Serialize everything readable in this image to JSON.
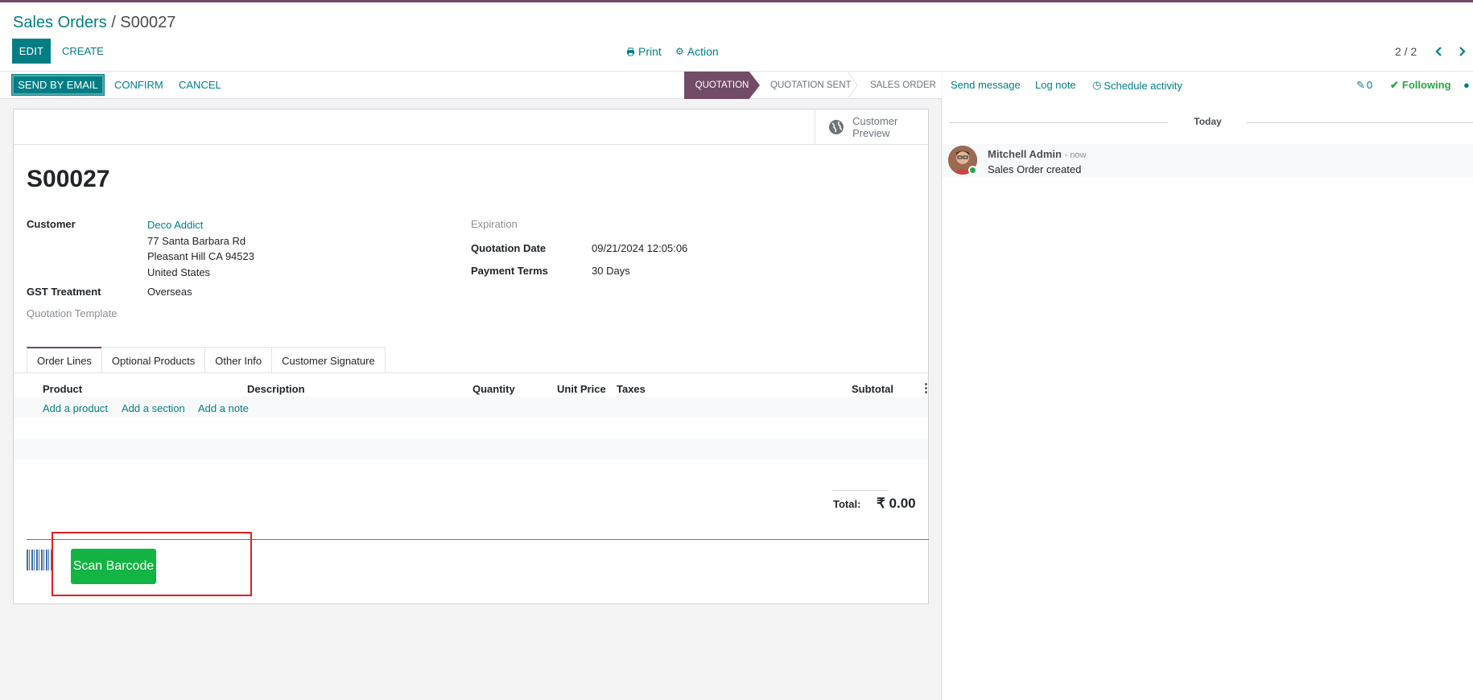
{
  "breadcrumb": {
    "parent": "Sales Orders",
    "sep": " / ",
    "current": "S00027"
  },
  "toolbar": {
    "edit": "EDIT",
    "create": "CREATE",
    "print": "Print",
    "action": "Action"
  },
  "pager": {
    "value": "2 / 2"
  },
  "statusbar": {
    "send_email": "SEND BY EMAIL",
    "confirm": "CONFIRM",
    "cancel": "CANCEL",
    "stages": [
      "QUOTATION",
      "QUOTATION SENT",
      "SALES ORDER"
    ],
    "active_stage": "QUOTATION"
  },
  "customer_preview": {
    "line1": "Customer",
    "line2": "Preview"
  },
  "order": {
    "name": "S00027",
    "customer_label": "Customer",
    "customer_name": "Deco Addict",
    "address1": "77 Santa Barbara Rd",
    "address2": "Pleasant Hill CA 94523",
    "address3": "United States",
    "gst_label": "GST Treatment",
    "gst_value": "Overseas",
    "template_label": "Quotation Template",
    "expiration_label": "Expiration",
    "qdate_label": "Quotation Date",
    "qdate_value": "09/21/2024 12:05:06",
    "terms_label": "Payment Terms",
    "terms_value": "30 Days"
  },
  "tabs": [
    "Order Lines",
    "Optional Products",
    "Other Info",
    "Customer Signature"
  ],
  "lines": {
    "headers": {
      "product": "Product",
      "description": "Description",
      "quantity": "Quantity",
      "unit_price": "Unit Price",
      "taxes": "Taxes",
      "subtotal": "Subtotal"
    },
    "add_product": "Add a product",
    "add_section": "Add a section",
    "add_note": "Add a note"
  },
  "totals": {
    "label": "Total:",
    "value": "₹ 0.00"
  },
  "barcode": {
    "button": "Scan Barcode"
  },
  "chatter": {
    "send_message": "Send message",
    "log_note": "Log note",
    "schedule": "Schedule activity",
    "attachments": "0",
    "following": "Following",
    "today": "Today",
    "message": {
      "author": "Mitchell Admin",
      "time": "- now",
      "body": "Sales Order created"
    }
  },
  "colors": {
    "brand": "#714b67",
    "accent": "#017e84",
    "success": "#12b443"
  }
}
